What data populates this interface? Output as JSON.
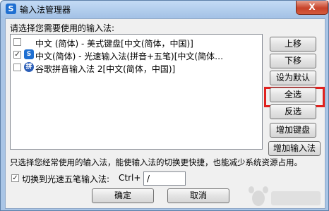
{
  "window": {
    "title": "输入法管理器",
    "close_label": "X"
  },
  "prompt": "请选择您需要使用的输入法:",
  "ime_list": [
    {
      "checked": false,
      "label": "中文 (简体) - 美式键盘[中文(简体，中国)]",
      "icon": "none"
    },
    {
      "checked": true,
      "label": "中文(简体) - 光速输入法(拼音+五笔)[中文(简体…",
      "icon": "lightspeed-icon"
    },
    {
      "checked": false,
      "label": "谷歌拼音输入法 2[中文(简体，中国)]",
      "icon": "google-pinyin-icon"
    }
  ],
  "buttons": {
    "move_up": "上移",
    "move_down": "下移",
    "set_default": "设为默认",
    "select_all": "全选",
    "invert": "反选",
    "add_keyboard": "增加键盘",
    "add_ime": "增加输入法"
  },
  "hint": "只选择您经常使用的输入法，能使输入法的切换更快捷，也能减少系统资源占用。",
  "shortcut": {
    "checked": true,
    "label": "切换到光速五笔输入法:",
    "modifier": "Ctrl+",
    "key": "/"
  },
  "footer": {
    "ok": "确定",
    "cancel": "取消"
  },
  "colors": {
    "highlight": "#e0221f",
    "titlebar": "#a9c5e6"
  }
}
